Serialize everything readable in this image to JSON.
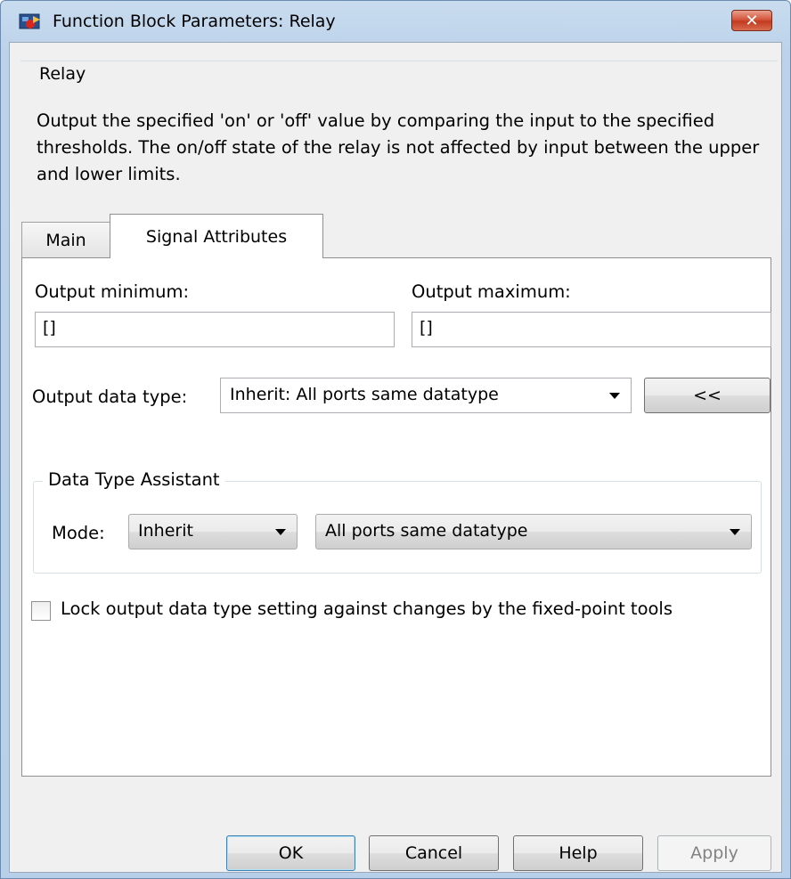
{
  "window": {
    "title": "Function Block Parameters: Relay",
    "close_label": "✕"
  },
  "relay": {
    "legend": "Relay",
    "description": "Output the specified 'on' or 'off' value by comparing the input to the specified thresholds.  The on/off state of the relay is not affected by input between the upper and lower limits."
  },
  "tabs": [
    {
      "label": "Main",
      "active": false
    },
    {
      "label": "Signal Attributes",
      "active": true
    }
  ],
  "signal": {
    "output_min_label": "Output minimum:",
    "output_min_value": "[]",
    "output_max_label": "Output maximum:",
    "output_max_value": "[]",
    "data_type_label": "Output data type:",
    "data_type_value": "Inherit: All ports same datatype",
    "toggle_assistant_label": "<<",
    "assistant": {
      "legend": "Data Type Assistant",
      "mode_label": "Mode:",
      "mode_value": "Inherit",
      "inherit_value": "All ports same datatype"
    },
    "lock_label": "Lock output data type setting against changes by the fixed-point tools",
    "lock_checked": false
  },
  "buttons": {
    "ok": "OK",
    "cancel": "Cancel",
    "help": "Help",
    "apply": "Apply"
  },
  "colors": {
    "title_bar": "#bcd2ea",
    "close_button": "#c23b1f",
    "panel": "#f0f0f0"
  }
}
